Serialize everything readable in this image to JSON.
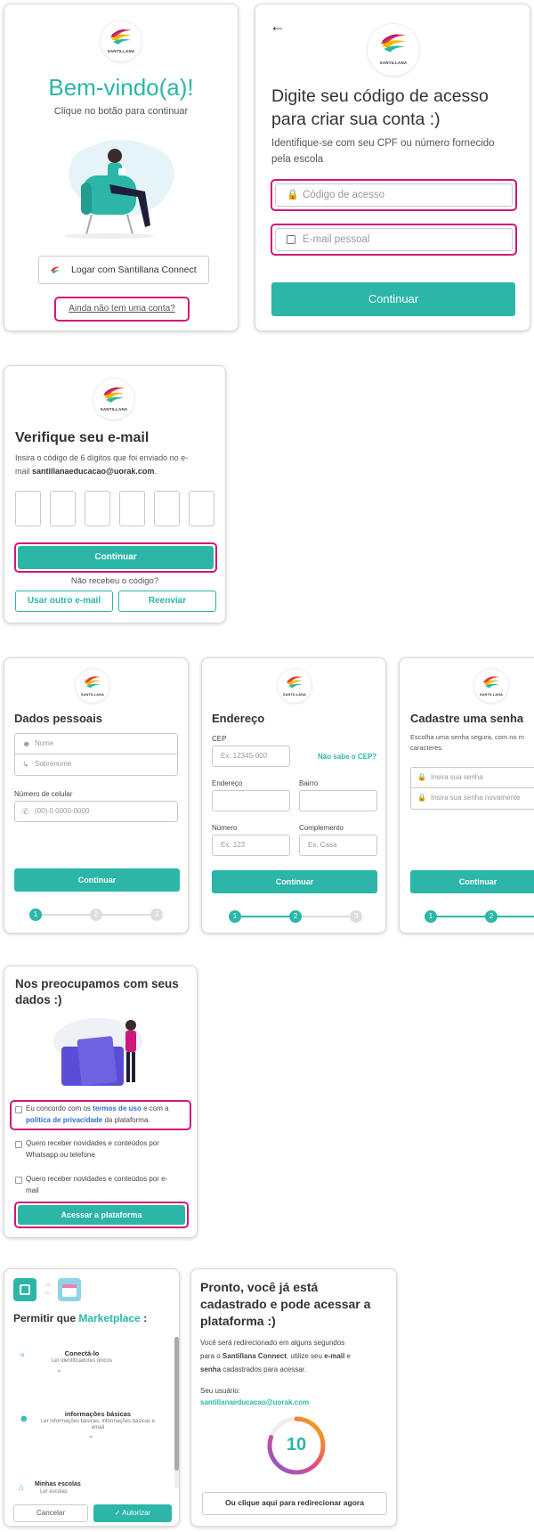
{
  "brand": {
    "logo_text": "SANTILLANA",
    "teal": "#2bb6a8",
    "highlight": "#d0177b"
  },
  "welcome": {
    "title": "Bem-vindo(a)!",
    "subtitle": "Clique no botão para continuar",
    "connect_button": "Logar com Santillana Connect",
    "signup_link": "Ainda não tem uma conta?"
  },
  "access": {
    "title_line1": "Digite seu código de acesso",
    "title_line2": "para criar sua conta :)",
    "desc_line1": "Identifique-se com seu CPF ou número fornecido",
    "desc_line2": "pela escola",
    "code_placeholder": "Código de acesso",
    "email_placeholder": "E-mail pessoal",
    "continue": "Continuar"
  },
  "verify": {
    "title": "Verifique seu e-mail",
    "desc_line1": "Insira o código de 6 dígitos que foi enviado no e-",
    "desc_prefix": "mail ",
    "email": "santillanaeducacao@uorak.com",
    "desc_suffix": ".",
    "continue": "Continuar",
    "no_code": "Não recebeu o código?",
    "other_email": "Usar outro e-mail",
    "resend": "Reenviar"
  },
  "personal": {
    "title": "Dados pessoais",
    "name_placeholder": "Nome",
    "surname_placeholder": "Sobrenome",
    "phone_label": "Número de celular",
    "phone_placeholder": "(00) 0 0000-0000",
    "continue": "Continuar",
    "steps": [
      "1",
      "2",
      "3"
    ]
  },
  "address": {
    "title": "Endereço",
    "cep_label": "CEP",
    "cep_placeholder": "Ex. 12345-000",
    "cep_link": "Não sabe o CEP?",
    "street_label": "Endereço",
    "district_label": "Bairro",
    "number_label": "Número",
    "number_placeholder": "Ex. 123",
    "complement_label": "Complemento",
    "complement_placeholder": "Ex. Casa",
    "continue": "Continuar",
    "steps": [
      "1",
      "2",
      "3"
    ]
  },
  "password": {
    "title": "Cadastre uma senha",
    "desc_line1": "Escolha uma senha segura, com no m",
    "desc_line2": "caracteres.",
    "pass_placeholder": "Insira sua senha",
    "pass2_placeholder": "Insira sua senha novamente",
    "continue": "Continuar",
    "steps": [
      "1",
      "2"
    ]
  },
  "privacy": {
    "title_line1": "Nos preocupamos com seus",
    "title_line2": "dados :)",
    "consent_prefix": "Eu concordo com os ",
    "terms": "termos de uso",
    "consent_mid": " e com a",
    "policy": "política de privacidade",
    "consent_suffix": " da plataforma.",
    "news_phone_line1": "Quero receber novidades e conteúdos por",
    "news_phone_line2": "Whatsapp ou telefone",
    "news_email_line1": "Quero receber novidades e conteúdos por e-",
    "news_email_line2": "mail",
    "access_button": "Acessar a plataforma"
  },
  "authorize": {
    "title_prefix": "Permitir que ",
    "app_name": "Marketplace",
    "title_suffix": " :",
    "perm1_title": "Conectá-lo",
    "perm1_desc": "Ler identificadores únicos",
    "perm2_title": "informações básicas",
    "perm2_desc_line1": "Ler informações básicas, informações básicas e",
    "perm2_desc_line2": "email",
    "perm3_title": "Minhas escolas",
    "perm3_desc": "Ler escolas",
    "cancel": "Cancelar",
    "authorize": "Autorizar"
  },
  "done": {
    "title_line1": "Pronto, você já está",
    "title_line2": "cadastrado e pode acessar a",
    "title_line3": "plataforma :)",
    "desc_line1": "Você será redirecionado em alguns segundos",
    "desc_line2_prefix": "para o ",
    "desc_line2_brand": "Santillana Connect",
    "desc_line2_mid": ", utilize seu ",
    "desc_line2_email": "e-mail",
    "desc_line2_suffix": " e",
    "desc_line3_strong": "senha",
    "desc_line3_rest": " cadastrados para acessar.",
    "user_label": "Seu usuário:",
    "user_email": "santillanaeducacao@uorak.com",
    "countdown": "10",
    "countdown_progress": 0.8,
    "redirect_button": "Ou clique aqui para redirecionar agora"
  }
}
